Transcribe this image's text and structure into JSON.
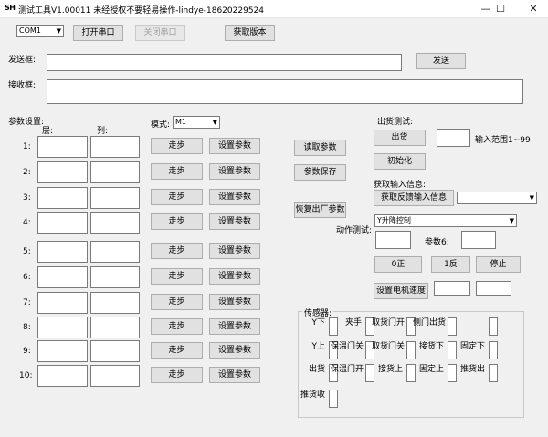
{
  "window": {
    "logo": "SH",
    "title": "测试工具V1.00011 未经授权不要轻易操作-lindye-18620229524",
    "minimize": "—",
    "maximize": "☐",
    "close": "✕"
  },
  "toolbar": {
    "port_value": "COM1",
    "open_port": "打开串口",
    "close_port": "关闭串口",
    "get_version": "获取版本"
  },
  "send": {
    "label": "发送框:",
    "value": "",
    "button": "发送"
  },
  "receive": {
    "label": "接收框:",
    "value": ""
  },
  "params": {
    "title": "参数设置:",
    "col_layer": "层:",
    "col_column": "列:",
    "mode_label": "模式:",
    "mode_value": "M1",
    "rows": [
      {
        "num": "1:",
        "step": "走步",
        "set": "设置参数"
      },
      {
        "num": "2:",
        "step": "走步",
        "set": "设置参数"
      },
      {
        "num": "3:",
        "step": "走步",
        "set": "设置参数"
      },
      {
        "num": "4:",
        "step": "走步",
        "set": "设置参数"
      },
      {
        "num": "5:",
        "step": "走步",
        "set": "设置参数"
      },
      {
        "num": "6:",
        "step": "走步",
        "set": "设置参数"
      },
      {
        "num": "7:",
        "step": "走步",
        "set": "设置参数"
      },
      {
        "num": "8:",
        "step": "走步",
        "set": "设置参数"
      },
      {
        "num": "9:",
        "step": "走步",
        "set": "设置参数"
      },
      {
        "num": "10:",
        "step": "走步",
        "set": "设置参数"
      }
    ],
    "read_params": "读取参数",
    "save_params": "参数保存",
    "factory_reset": "恢复出厂参数"
  },
  "shipping": {
    "title": "出货测试:",
    "ship_button": "出货",
    "range_label": "输入范围1~99",
    "init_button": "初始化"
  },
  "input_info": {
    "title": "获取输入信息:",
    "get_feedback": "获取反馈输入信息",
    "select_value": ""
  },
  "action": {
    "select_value": "Y升降控制",
    "title": "动作测试:",
    "param_label": "参数6:",
    "forward": "0正",
    "reverse": "1反",
    "stop": "停止",
    "set_motor_speed": "设置电机速度"
  },
  "sensors": {
    "title": "传感器:",
    "items": [
      {
        "label": "Y下"
      },
      {
        "label": "夹手"
      },
      {
        "label": "取货门开"
      },
      {
        "label": "侧门出货"
      },
      {
        "label": ""
      },
      {
        "label": "Y上"
      },
      {
        "label": "保温门关"
      },
      {
        "label": "取货门关"
      },
      {
        "label": "接货下"
      },
      {
        "label": "固定下"
      },
      {
        "label": "出货"
      },
      {
        "label": "保温门开"
      },
      {
        "label": "接货上"
      },
      {
        "label": "固定上"
      },
      {
        "label": "推货出"
      },
      {
        "label": "推货收"
      }
    ]
  }
}
